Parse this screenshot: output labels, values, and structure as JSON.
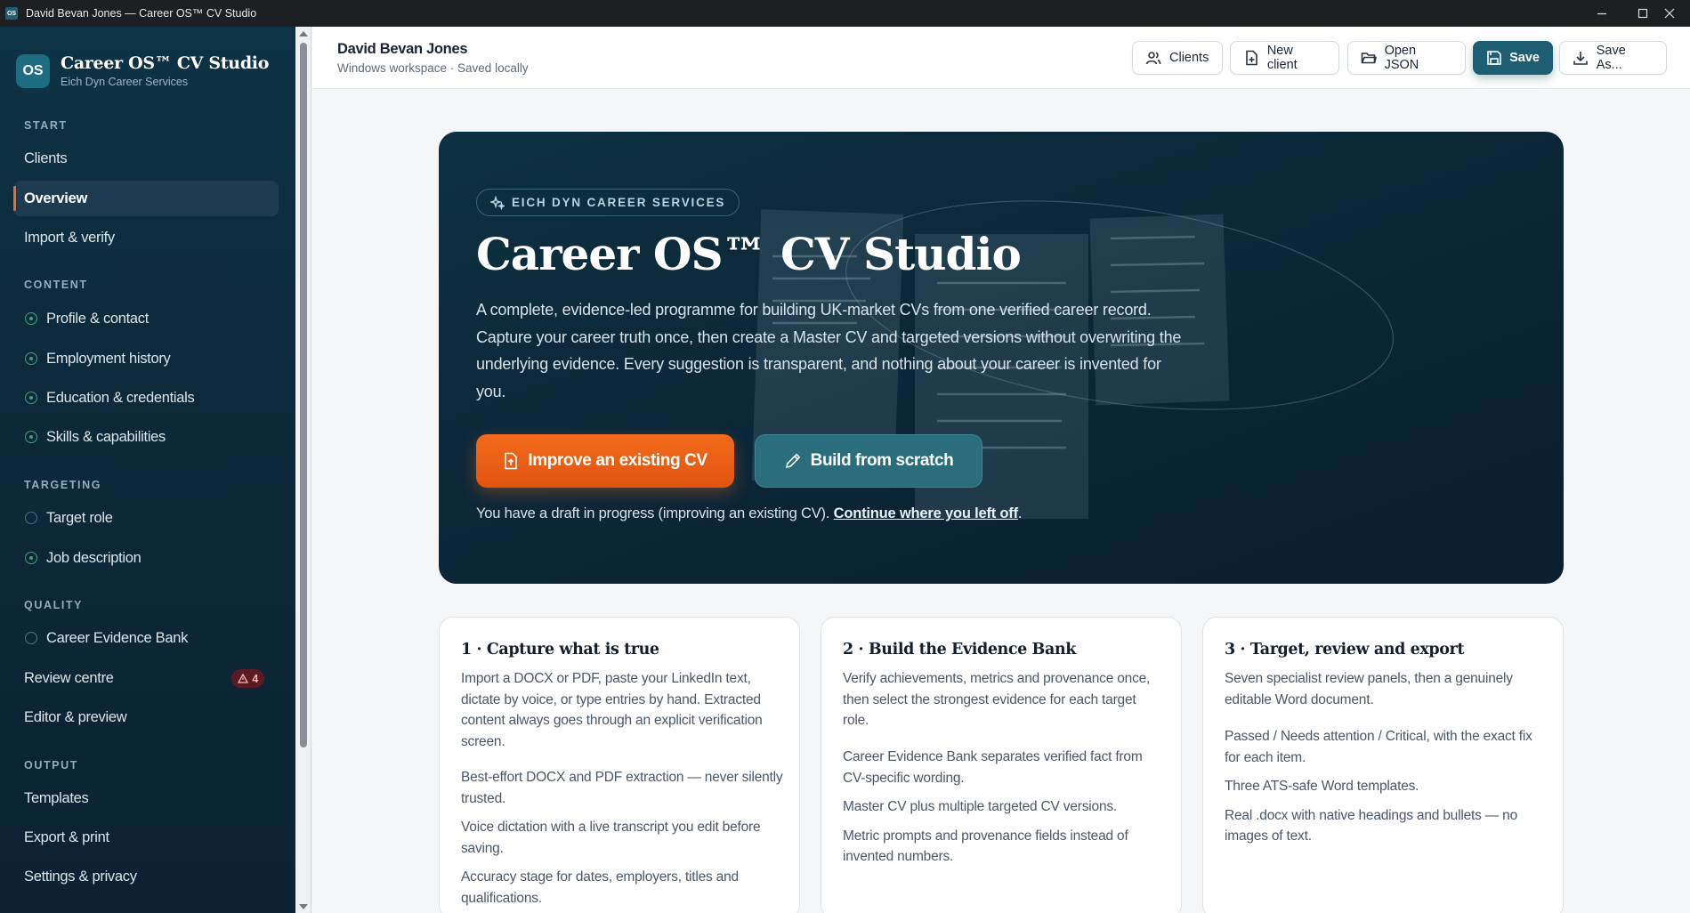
{
  "window": {
    "title": "David Bevan Jones — Career OS™ CV Studio",
    "app_icon_text": "OS"
  },
  "brand": {
    "logo": "OS",
    "name": "Career OS™ CV Studio",
    "subtitle": "Eich Dyn Career Services"
  },
  "sidebar": {
    "sections": {
      "start": "START",
      "content": "CONTENT",
      "targeting": "TARGETING",
      "quality": "QUALITY",
      "output": "OUTPUT"
    },
    "items": {
      "clients": "Clients",
      "overview": "Overview",
      "import": "Import & verify",
      "profile": "Profile & contact",
      "employment": "Employment history",
      "education": "Education & credentials",
      "skills": "Skills & capabilities",
      "target_role": "Target role",
      "job_description": "Job description",
      "evidence_bank": "Career Evidence Bank",
      "review_centre": "Review centre",
      "review_badge": "4",
      "editor": "Editor & preview",
      "templates": "Templates",
      "export": "Export & print",
      "settings": "Settings & privacy"
    }
  },
  "header": {
    "client_name": "David Bevan Jones",
    "status": "Windows workspace · Saved locally",
    "buttons": {
      "clients": "Clients",
      "new_client": "New client",
      "open_json": "Open JSON",
      "save": "Save",
      "save_as": "Save As..."
    }
  },
  "hero": {
    "pill": "EICH DYN CAREER SERVICES",
    "title": "Career OS™ CV Studio",
    "description": "A complete, evidence-led programme for building UK-market CVs from one verified career record. Capture your career truth once, then create a Master CV and targeted versions without overwriting the underlying evidence. Every suggestion is transparent, and nothing about your career is invented for you.",
    "improve_button": "Improve an existing CV",
    "scratch_button": "Build from scratch",
    "draft_text": "You have a draft in progress (improving an existing CV). ",
    "draft_link": "Continue where you left off",
    "draft_end": "."
  },
  "cards": [
    {
      "title": "1 · Capture what is true",
      "intro": "Import a DOCX or PDF, paste your LinkedIn text, dictate by voice, or type entries by hand. Extracted content always goes through an explicit verification screen.",
      "bullets": [
        "Best-effort DOCX and PDF extraction — never silently trusted.",
        "Voice dictation with a live transcript you edit before saving.",
        "Accuracy stage for dates, employers, titles and qualifications."
      ]
    },
    {
      "title": "2 · Build the Evidence Bank",
      "intro": "Verify achievements, metrics and provenance once, then select the strongest evidence for each target role.",
      "bullets": [
        "Career Evidence Bank separates verified fact from CV-specific wording.",
        "Master CV plus multiple targeted CV versions.",
        "Metric prompts and provenance fields instead of invented numbers."
      ]
    },
    {
      "title": "3 · Target, review and export",
      "intro": "Seven specialist review panels, then a genuinely editable Word document.",
      "bullets": [
        "Passed / Needs attention / Critical, with the exact fix for each item.",
        "Three ATS-safe Word templates.",
        "Real .docx with native headings and bullets — no images of text."
      ]
    }
  ]
}
